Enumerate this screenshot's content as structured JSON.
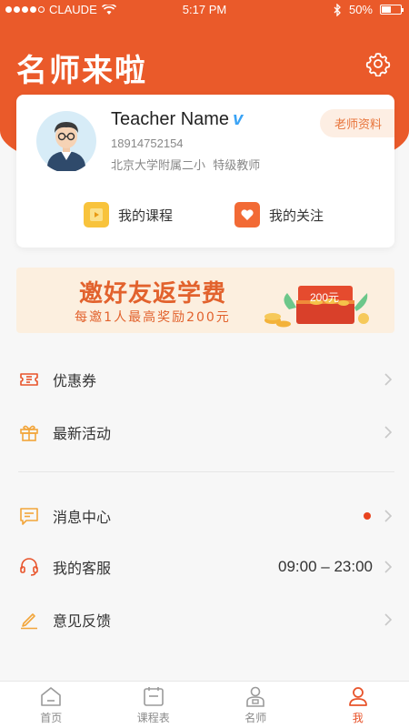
{
  "status_bar": {
    "carrier": "CLAUDE",
    "time": "5:17 PM",
    "battery": "50%",
    "battery_level": 0.5
  },
  "header": {
    "logo_text": "名师来啦",
    "settings_icon": "gear-icon"
  },
  "profile": {
    "name": "Teacher Name",
    "verified_mark": "v",
    "phone": "18914752154",
    "school": "北京大学附属二小",
    "title": "特级教师",
    "profile_button": "老师资料",
    "quick_links": [
      {
        "label": "我的课程",
        "icon": "course-icon"
      },
      {
        "label": "我的关注",
        "icon": "heart-icon"
      }
    ]
  },
  "banner": {
    "title": "邀好友返学费",
    "subtitle": "每邀1人最高奖励200元",
    "badge": "200元"
  },
  "menu": {
    "coupons": "优惠券",
    "activities": "最新活动",
    "messages": "消息中心",
    "service": "我的客服",
    "service_hours": "09:00 – 23:00",
    "feedback": "意见反馈"
  },
  "tabbar": {
    "home": "首页",
    "schedule": "课程表",
    "teachers": "名师",
    "me": "我"
  },
  "colors": {
    "accent": "#ea5a2a",
    "orange_light": "#fdeee3",
    "verify_blue": "#3aa3f5"
  }
}
